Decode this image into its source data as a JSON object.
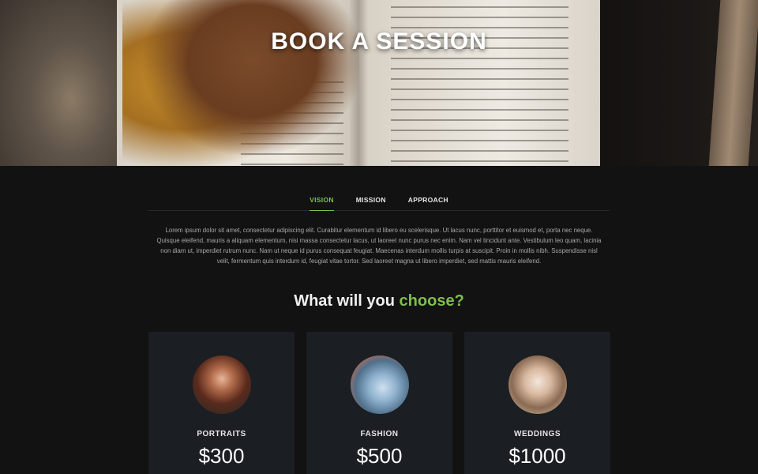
{
  "hero": {
    "title": "BOOK A SESSION"
  },
  "tabs": [
    {
      "label": "VISION",
      "active": true
    },
    {
      "label": "MISSION",
      "active": false
    },
    {
      "label": "APPROACH",
      "active": false
    }
  ],
  "intro_text": "Lorem ipsum dolor sit amet, consectetur adipiscing elit. Curabitur elementum id libero eu scelerisque. Ut lacus nunc, porttitor et euismod et, porta nec neque. Quisque eleifend, mauris a aliquam elementum, nisi massa consectetur lacus, ut laoreet nunc purus nec enim. Nam vel tincidunt ante. Vestibulum leo quam, lacinia non diam ut, imperdiet rutrum nunc. Nam ut neque id purus consequat feugiat. Maecenas interdum mollis turpis at suscipit. Proin in mollis nibh. Suspendisse nisl velit, fermentum quis interdum id, feugiat vitae tortor. Sed laoreet magna ut libero imperdiet, sed mattis mauris eleifend.",
  "choose": {
    "prefix": "What will you ",
    "accent": "choose?"
  },
  "colors": {
    "accent": "#7fbf4d",
    "background": "#121212",
    "card": "#1b1e22"
  },
  "cards": [
    {
      "name": "PORTRAITS",
      "price": "$300",
      "image": "portrait-photo"
    },
    {
      "name": "FASHION",
      "price": "$500",
      "image": "sneaker-photo"
    },
    {
      "name": "WEDDINGS",
      "price": "$1000",
      "image": "bride-photo"
    }
  ]
}
